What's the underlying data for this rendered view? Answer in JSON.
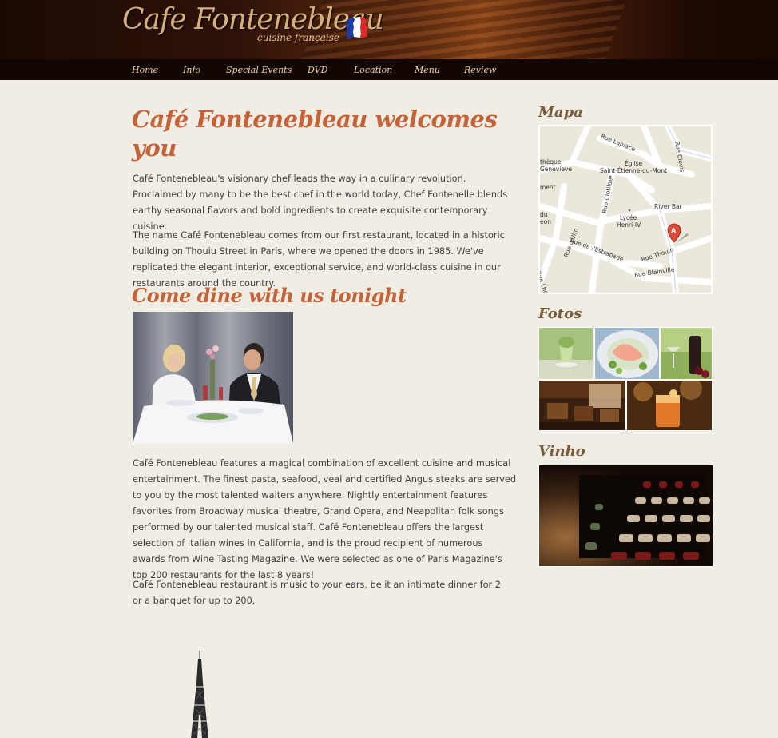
{
  "header": {
    "logo_title": "Cafe Fontenebleau",
    "logo_subtitle": "cuisine française"
  },
  "nav": {
    "items": [
      "Home",
      "Info",
      "Special Events",
      "DVD",
      "Location",
      "Menu",
      "Review"
    ]
  },
  "main": {
    "welcome_heading": "Café Fontenebleau welcomes you",
    "intro_paragraph_1": "Café Fontenebleau's visionary chef leads the way in a culinary revolution. Proclaimed by many to be the best chef in the world today, Chef Fontenelle blends earthy seasonal flavors and bold ingredients to create exquisite contemporary cuisine.",
    "intro_paragraph_2": "The name Café Fontenebleau comes from our first restaurant, located in a historic building on Thouiu Street in Paris, where we opened the doors in 1985. We've replicated the elegant interior, exceptional service, and world-class cuisine in our restaurants around the country.",
    "dine_heading": "Come dine with us tonight",
    "dine_paragraph_1": "Café Fontenebleau features a magical combination of excellent cuisine and musical entertainment. The finest pasta, seafood, veal and certified Angus steaks are served to you by the most talented waiters anywhere. Nightly entertainment features favorites from Broadway musical theatre, Grand Opera, and Neapolitan folk songs performed by our talented musical staff. Café Fontenebleau offers the largest selection of Italian wines in California, and is the proud recipient of numerous awards from Wine Tasting Magazine. We were selected as one of Paris Magazine's top 200 restaurants for the last 8 years!",
    "dine_paragraph_2": "Café Fontenebleau restaurant is music to your ears, be it an intimate dinner for 2 or a banquet for up to 200."
  },
  "sidebar": {
    "map_heading": "Mapa",
    "map_labels": {
      "rue_laplace": "Rue Laplace",
      "rue_clovis": "Rue Clovis",
      "eglise_1": "Église",
      "eglise_2": "Saint-Étienne-du-Mont",
      "bib_1": "thèque",
      "bib_2": "Genevieve",
      "ment": "ment",
      "rue_clotilde": "Rue Clotilde",
      "river_bar": "River Bar",
      "lycee_1": "Lycée",
      "lycee_2": "Henri-IV",
      "du_1": "du",
      "du_2": "eon",
      "rue_ulm": "Rue d'Ulm",
      "rue_estrapade": "Rue de l'Estrapade",
      "rue_thouin": "Rue Thouin",
      "rue_blainville": "Rue Blainville",
      "rue_lhomond": "Rue Lhomond",
      "marker": "A"
    },
    "photos_heading": "Fotos",
    "wine_heading": "Vinho"
  },
  "colors": {
    "background": "#f0eee4",
    "heading_accent": "#c4623a",
    "sidebar_heading": "#7a5b3a",
    "nav_background": "#120603",
    "nav_text": "#efd3a4",
    "logo_text": "#d6b07a"
  }
}
